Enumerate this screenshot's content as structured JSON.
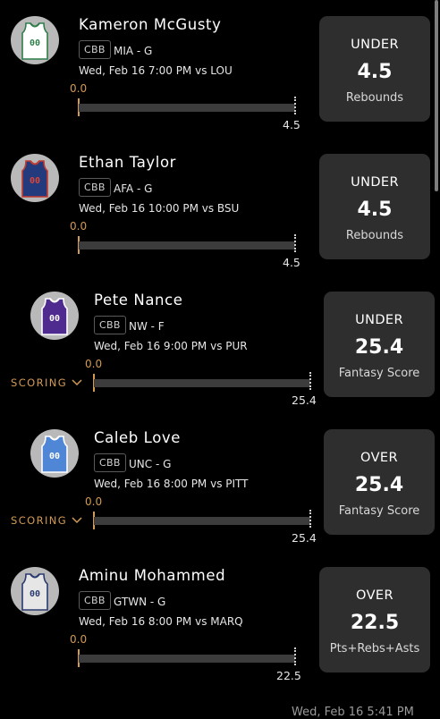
{
  "picks": [
    {
      "player": "Kameron McGusty",
      "league": "CBB",
      "team_pos": "MIA - G",
      "game": "Wed, Feb 16 7:00 PM vs LOU",
      "start_value": "0.0",
      "end_value": "4.5",
      "direction": "UNDER",
      "line": "4.5",
      "stat": "Rebounds",
      "jersey": {
        "body": "#ffffff",
        "trim": "#2f7d4a",
        "number": "00",
        "number_color": "#2f7d4a"
      }
    },
    {
      "player": "Ethan Taylor",
      "league": "CBB",
      "team_pos": "AFA - G",
      "game": "Wed, Feb 16 10:00 PM vs BSU",
      "start_value": "0.0",
      "end_value": "4.5",
      "direction": "UNDER",
      "line": "4.5",
      "stat": "Rebounds",
      "jersey": {
        "body": "#233a7d",
        "trim": "#c23a30",
        "number": "00",
        "number_color": "#d8473b"
      }
    },
    {
      "player": "Pete Nance",
      "league": "CBB",
      "team_pos": "NW - F",
      "game": "Wed, Feb 16 9:00 PM vs PUR",
      "start_value": "0.0",
      "end_value": "25.4",
      "direction": "UNDER",
      "line": "25.4",
      "stat": "Fantasy Score",
      "scoring_label": "SCORING",
      "jersey": {
        "body": "#4f2a8f",
        "trim": "#ffffff",
        "number": "00",
        "number_color": "#ffffff"
      }
    },
    {
      "player": "Caleb Love",
      "league": "CBB",
      "team_pos": "UNC - G",
      "game": "Wed, Feb 16 8:00 PM vs PITT",
      "start_value": "0.0",
      "end_value": "25.4",
      "direction": "OVER",
      "line": "25.4",
      "stat": "Fantasy Score",
      "scoring_label": "SCORING",
      "jersey": {
        "body": "#4f86d6",
        "trim": "#ffffff",
        "number": "00",
        "number_color": "#ffffff"
      }
    },
    {
      "player": "Aminu Mohammed",
      "league": "CBB",
      "team_pos": "GTWN - G",
      "game": "Wed, Feb 16 8:00 PM vs MARQ",
      "start_value": "0.0",
      "end_value": "22.5",
      "direction": "OVER",
      "line": "22.5",
      "stat": "Pts+Rebs+Asts",
      "jersey": {
        "body": "#e6e6e6",
        "trim": "#2a3a6e",
        "number": "00",
        "number_color": "#2a3a6e"
      }
    }
  ],
  "footer": {
    "timestamp": "Wed, Feb 16 5:41 PM"
  },
  "colors": {
    "accent": "#d29a54",
    "card": "#2e2e2e",
    "track": "#3c3c3c",
    "background": "#000000"
  }
}
